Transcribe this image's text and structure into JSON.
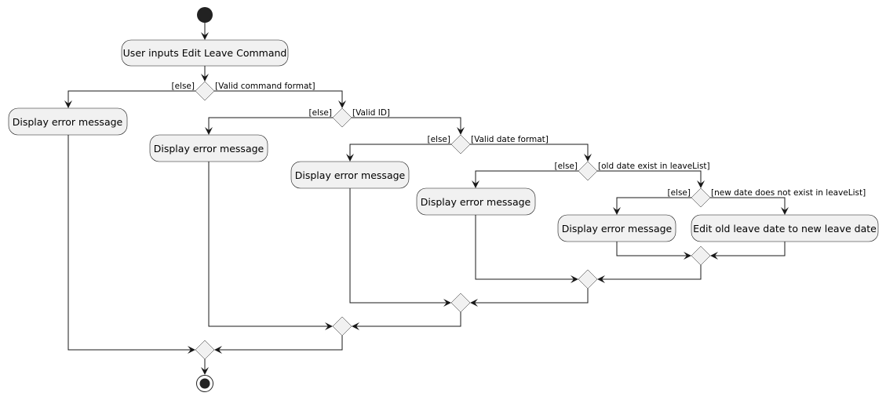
{
  "diagram": {
    "type": "uml-activity",
    "start_label": "start",
    "end_label": "stop",
    "actions": {
      "input": "User inputs Edit Leave Command",
      "error1": "Display error message",
      "error2": "Display error message",
      "error3": "Display error message",
      "error4": "Display error message",
      "error5": "Display error message",
      "success": "Edit old leave date to new leave date"
    },
    "decisions": [
      {
        "id": "d1",
        "else": "[else]",
        "then": "[Valid command format]"
      },
      {
        "id": "d2",
        "else": "[else]",
        "then": "[Valid ID]"
      },
      {
        "id": "d3",
        "else": "[else]",
        "then": "[Valid date format]"
      },
      {
        "id": "d4",
        "else": "[else]",
        "then": "[old date exist in leaveList]"
      },
      {
        "id": "d5",
        "else": "[else]",
        "then": "[new date does not exist in leaveList]"
      }
    ]
  }
}
